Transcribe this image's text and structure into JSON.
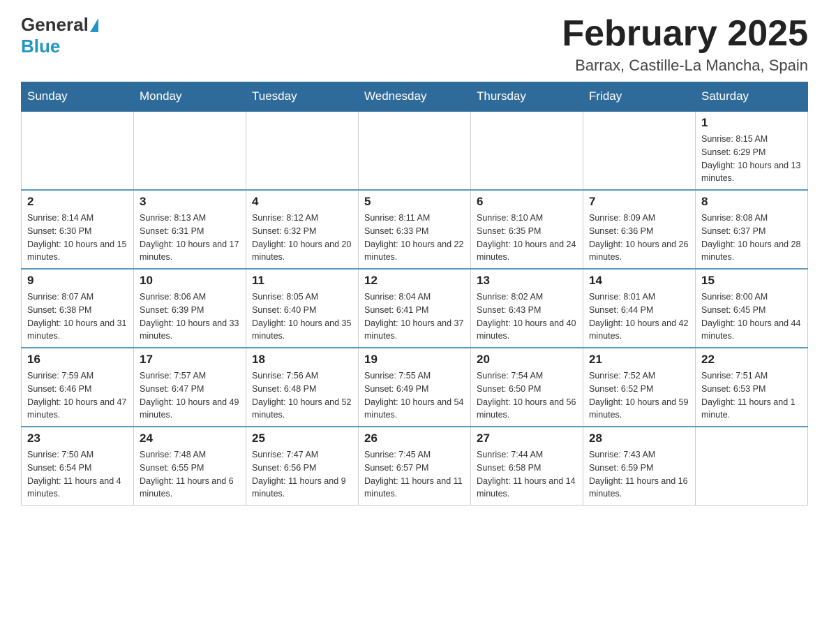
{
  "logo": {
    "general": "General",
    "blue": "Blue"
  },
  "header": {
    "month": "February 2025",
    "location": "Barrax, Castille-La Mancha, Spain"
  },
  "weekdays": [
    "Sunday",
    "Monday",
    "Tuesday",
    "Wednesday",
    "Thursday",
    "Friday",
    "Saturday"
  ],
  "weeks": [
    [
      {
        "day": "",
        "info": ""
      },
      {
        "day": "",
        "info": ""
      },
      {
        "day": "",
        "info": ""
      },
      {
        "day": "",
        "info": ""
      },
      {
        "day": "",
        "info": ""
      },
      {
        "day": "",
        "info": ""
      },
      {
        "day": "1",
        "info": "Sunrise: 8:15 AM\nSunset: 6:29 PM\nDaylight: 10 hours and 13 minutes."
      }
    ],
    [
      {
        "day": "2",
        "info": "Sunrise: 8:14 AM\nSunset: 6:30 PM\nDaylight: 10 hours and 15 minutes."
      },
      {
        "day": "3",
        "info": "Sunrise: 8:13 AM\nSunset: 6:31 PM\nDaylight: 10 hours and 17 minutes."
      },
      {
        "day": "4",
        "info": "Sunrise: 8:12 AM\nSunset: 6:32 PM\nDaylight: 10 hours and 20 minutes."
      },
      {
        "day": "5",
        "info": "Sunrise: 8:11 AM\nSunset: 6:33 PM\nDaylight: 10 hours and 22 minutes."
      },
      {
        "day": "6",
        "info": "Sunrise: 8:10 AM\nSunset: 6:35 PM\nDaylight: 10 hours and 24 minutes."
      },
      {
        "day": "7",
        "info": "Sunrise: 8:09 AM\nSunset: 6:36 PM\nDaylight: 10 hours and 26 minutes."
      },
      {
        "day": "8",
        "info": "Sunrise: 8:08 AM\nSunset: 6:37 PM\nDaylight: 10 hours and 28 minutes."
      }
    ],
    [
      {
        "day": "9",
        "info": "Sunrise: 8:07 AM\nSunset: 6:38 PM\nDaylight: 10 hours and 31 minutes."
      },
      {
        "day": "10",
        "info": "Sunrise: 8:06 AM\nSunset: 6:39 PM\nDaylight: 10 hours and 33 minutes."
      },
      {
        "day": "11",
        "info": "Sunrise: 8:05 AM\nSunset: 6:40 PM\nDaylight: 10 hours and 35 minutes."
      },
      {
        "day": "12",
        "info": "Sunrise: 8:04 AM\nSunset: 6:41 PM\nDaylight: 10 hours and 37 minutes."
      },
      {
        "day": "13",
        "info": "Sunrise: 8:02 AM\nSunset: 6:43 PM\nDaylight: 10 hours and 40 minutes."
      },
      {
        "day": "14",
        "info": "Sunrise: 8:01 AM\nSunset: 6:44 PM\nDaylight: 10 hours and 42 minutes."
      },
      {
        "day": "15",
        "info": "Sunrise: 8:00 AM\nSunset: 6:45 PM\nDaylight: 10 hours and 44 minutes."
      }
    ],
    [
      {
        "day": "16",
        "info": "Sunrise: 7:59 AM\nSunset: 6:46 PM\nDaylight: 10 hours and 47 minutes."
      },
      {
        "day": "17",
        "info": "Sunrise: 7:57 AM\nSunset: 6:47 PM\nDaylight: 10 hours and 49 minutes."
      },
      {
        "day": "18",
        "info": "Sunrise: 7:56 AM\nSunset: 6:48 PM\nDaylight: 10 hours and 52 minutes."
      },
      {
        "day": "19",
        "info": "Sunrise: 7:55 AM\nSunset: 6:49 PM\nDaylight: 10 hours and 54 minutes."
      },
      {
        "day": "20",
        "info": "Sunrise: 7:54 AM\nSunset: 6:50 PM\nDaylight: 10 hours and 56 minutes."
      },
      {
        "day": "21",
        "info": "Sunrise: 7:52 AM\nSunset: 6:52 PM\nDaylight: 10 hours and 59 minutes."
      },
      {
        "day": "22",
        "info": "Sunrise: 7:51 AM\nSunset: 6:53 PM\nDaylight: 11 hours and 1 minute."
      }
    ],
    [
      {
        "day": "23",
        "info": "Sunrise: 7:50 AM\nSunset: 6:54 PM\nDaylight: 11 hours and 4 minutes."
      },
      {
        "day": "24",
        "info": "Sunrise: 7:48 AM\nSunset: 6:55 PM\nDaylight: 11 hours and 6 minutes."
      },
      {
        "day": "25",
        "info": "Sunrise: 7:47 AM\nSunset: 6:56 PM\nDaylight: 11 hours and 9 minutes."
      },
      {
        "day": "26",
        "info": "Sunrise: 7:45 AM\nSunset: 6:57 PM\nDaylight: 11 hours and 11 minutes."
      },
      {
        "day": "27",
        "info": "Sunrise: 7:44 AM\nSunset: 6:58 PM\nDaylight: 11 hours and 14 minutes."
      },
      {
        "day": "28",
        "info": "Sunrise: 7:43 AM\nSunset: 6:59 PM\nDaylight: 11 hours and 16 minutes."
      },
      {
        "day": "",
        "info": ""
      }
    ]
  ]
}
